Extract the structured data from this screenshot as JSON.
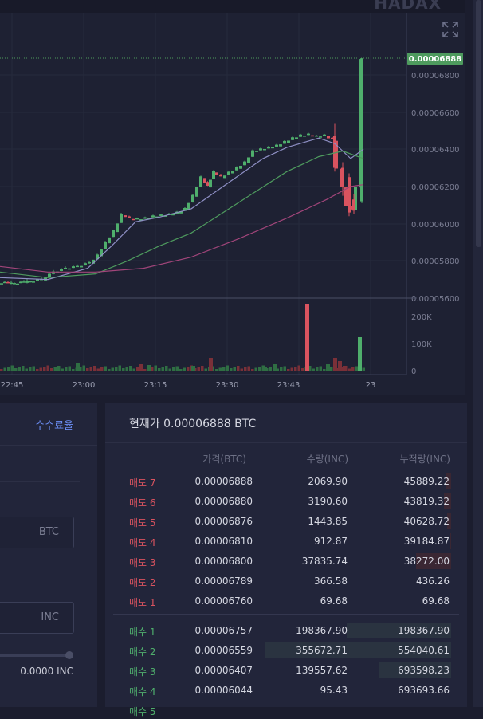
{
  "brand": "HADAX",
  "chart": {
    "last_price_badge": "0.00006888",
    "price_ticks": [
      "0.00006800",
      "0.00006600",
      "0.00006400",
      "0.00006200",
      "0.00006000",
      "0.00005800",
      "0.00005600"
    ],
    "volume_ticks": [
      "200K",
      "100K",
      "0"
    ],
    "time_ticks": [
      "22:45",
      "23:00",
      "23:15",
      "23:30",
      "23:43",
      "23"
    ]
  },
  "colors": {
    "up": "#4fae6c",
    "down": "#d9535f",
    "accent": "#6c8ef5",
    "badge": "#4e9b5e"
  },
  "left": {
    "fee_link": "수수료율",
    "price_unit": "BTC",
    "qty_unit": "INC",
    "amount": "0.0000 INC"
  },
  "orderbook": {
    "title": "현재가 0.00006888 BTC",
    "headers": {
      "price": "가격(BTC)",
      "qty": "수량(INC)",
      "cum": "누적량(INC)"
    },
    "asks": [
      {
        "label": "매도 7",
        "price": "0.00006888",
        "qty": "2069.90",
        "cum": "45889.22",
        "depth": 0.03
      },
      {
        "label": "매도 6",
        "price": "0.00006880",
        "qty": "3190.60",
        "cum": "43819.32",
        "depth": 0.04
      },
      {
        "label": "매도 5",
        "price": "0.00006876",
        "qty": "1443.85",
        "cum": "40628.72",
        "depth": 0.02
      },
      {
        "label": "매도 4",
        "price": "0.00006810",
        "qty": "912.87",
        "cum": "39184.87",
        "depth": 0.01
      },
      {
        "label": "매도 3",
        "price": "0.00006800",
        "qty": "37835.74",
        "cum": "38272.00",
        "depth": 0.19
      },
      {
        "label": "매도 2",
        "price": "0.00006789",
        "qty": "366.58",
        "cum": "436.26",
        "depth": 0.0
      },
      {
        "label": "매도 1",
        "price": "0.00006760",
        "qty": "69.68",
        "cum": "69.68",
        "depth": 0.0
      }
    ],
    "bids": [
      {
        "label": "매수 1",
        "price": "0.00006757",
        "qty": "198367.90",
        "cum": "198367.90",
        "depth": 0.56
      },
      {
        "label": "매수 2",
        "price": "0.00006559",
        "qty": "355672.71",
        "cum": "554040.61",
        "depth": 1.0
      },
      {
        "label": "매수 3",
        "price": "0.00006407",
        "qty": "139557.62",
        "cum": "693598.23",
        "depth": 0.39
      },
      {
        "label": "매수 4",
        "price": "0.00006044",
        "qty": "95.43",
        "cum": "693693.66",
        "depth": 0.0
      },
      {
        "label": "매수 5",
        "price": "",
        "qty": "",
        "cum": "",
        "depth": 0.0
      }
    ]
  }
}
